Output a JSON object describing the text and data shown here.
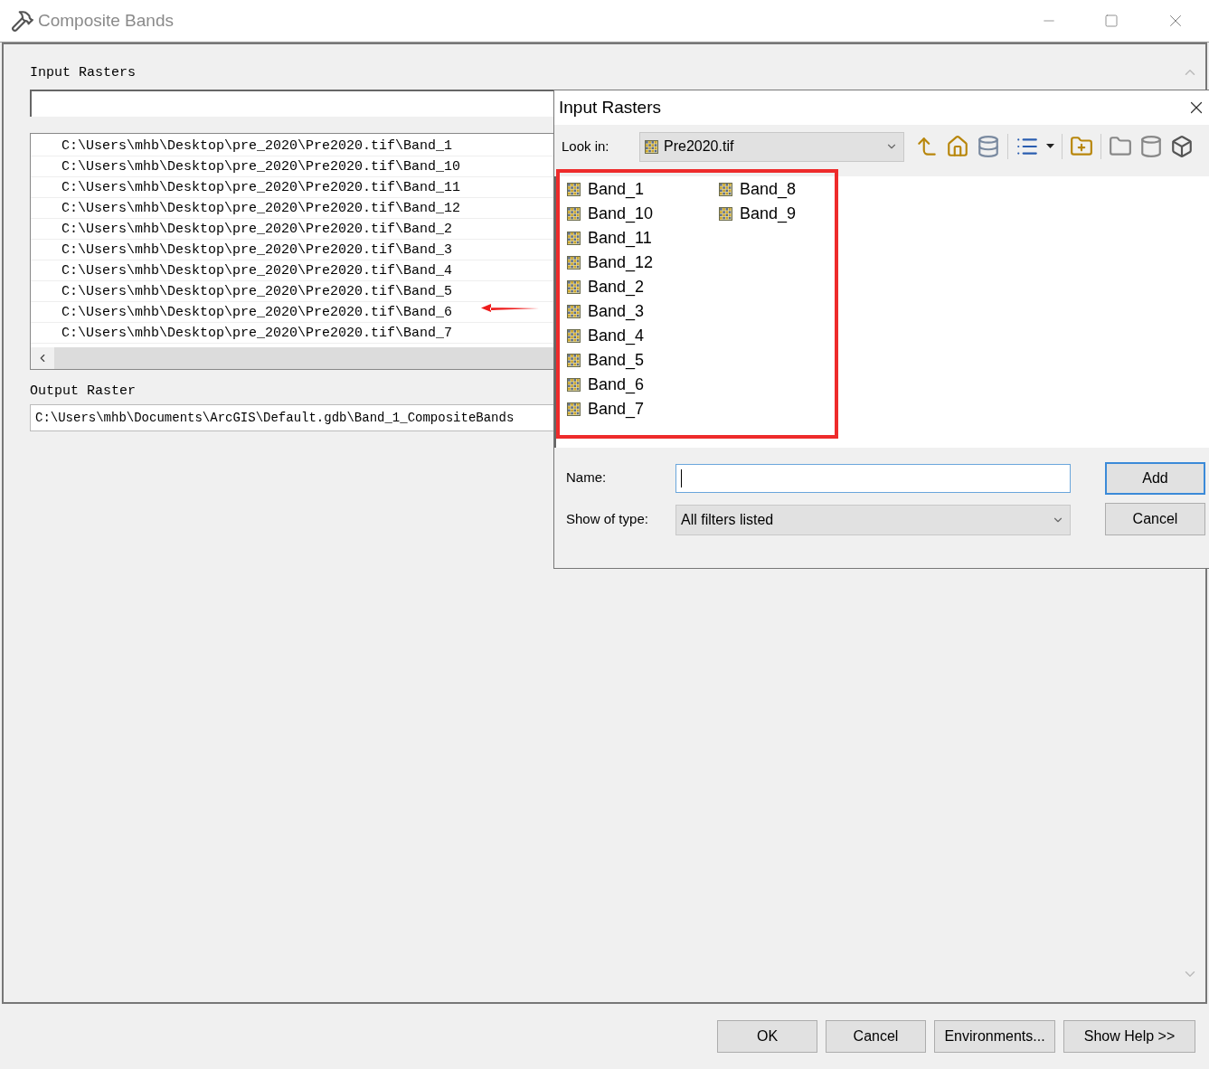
{
  "window": {
    "title": "Composite Bands"
  },
  "input_rasters": {
    "label": "Input Rasters",
    "items": [
      "C:\\Users\\mhb\\Desktop\\pre_2020\\Pre2020.tif\\Band_1",
      "C:\\Users\\mhb\\Desktop\\pre_2020\\Pre2020.tif\\Band_10",
      "C:\\Users\\mhb\\Desktop\\pre_2020\\Pre2020.tif\\Band_11",
      "C:\\Users\\mhb\\Desktop\\pre_2020\\Pre2020.tif\\Band_12",
      "C:\\Users\\mhb\\Desktop\\pre_2020\\Pre2020.tif\\Band_2",
      "C:\\Users\\mhb\\Desktop\\pre_2020\\Pre2020.tif\\Band_3",
      "C:\\Users\\mhb\\Desktop\\pre_2020\\Pre2020.tif\\Band_4",
      "C:\\Users\\mhb\\Desktop\\pre_2020\\Pre2020.tif\\Band_5",
      "C:\\Users\\mhb\\Desktop\\pre_2020\\Pre2020.tif\\Band_6",
      "C:\\Users\\mhb\\Desktop\\pre_2020\\Pre2020.tif\\Band_7"
    ]
  },
  "output_raster": {
    "label": "Output Raster",
    "value": "C:\\Users\\mhb\\Documents\\ArcGIS\\Default.gdb\\Band_1_CompositeBands"
  },
  "buttons": [
    "OK",
    "Cancel",
    "Environments...",
    "Show Help >>"
  ],
  "file_dialog": {
    "title": "Input Rasters",
    "look_in": {
      "label": "Look in:",
      "value": "Pre2020.tif"
    },
    "files": [
      "Band_1",
      "Band_10",
      "Band_11",
      "Band_12",
      "Band_2",
      "Band_3",
      "Band_4",
      "Band_5",
      "Band_6",
      "Band_7",
      "Band_8",
      "Band_9"
    ],
    "name_label": "Name:",
    "type": {
      "label": "Show of type:",
      "value": "All filters listed"
    },
    "buttons": [
      "Add",
      "Cancel"
    ]
  }
}
